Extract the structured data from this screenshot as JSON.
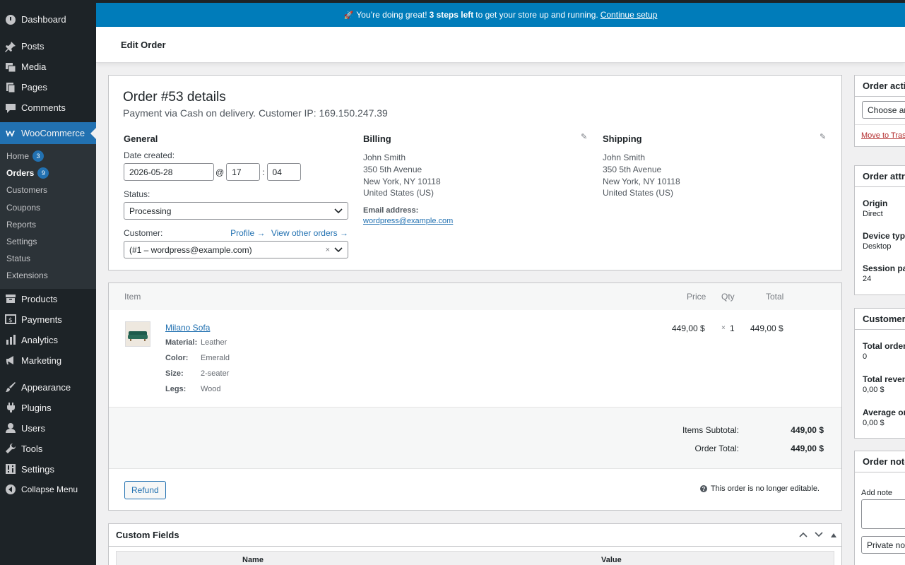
{
  "sidebar": {
    "top_items": [
      {
        "label": "Dashboard",
        "icon": "dashboard-icon"
      },
      {
        "label": "Posts",
        "icon": "pin-icon"
      },
      {
        "label": "Media",
        "icon": "media-icon"
      },
      {
        "label": "Pages",
        "icon": "pages-icon"
      },
      {
        "label": "Comments",
        "icon": "comment-icon"
      }
    ],
    "woocommerce_label": "WooCommerce",
    "sub_items": [
      {
        "label": "Home",
        "count": "3"
      },
      {
        "label": "Orders",
        "count": "9"
      },
      {
        "label": "Customers"
      },
      {
        "label": "Coupons"
      },
      {
        "label": "Reports"
      },
      {
        "label": "Settings"
      },
      {
        "label": "Status"
      },
      {
        "label": "Extensions"
      }
    ],
    "lower_items": [
      {
        "label": "Products"
      },
      {
        "label": "Payments"
      },
      {
        "label": "Analytics"
      },
      {
        "label": "Marketing"
      },
      {
        "label": "Appearance"
      },
      {
        "label": "Plugins"
      },
      {
        "label": "Users"
      },
      {
        "label": "Tools"
      },
      {
        "label": "Settings"
      },
      {
        "label": "Collapse Menu"
      }
    ]
  },
  "notice": {
    "emoji": "🚀",
    "text_before": "You’re doing great!",
    "bold": "3 steps left",
    "text_after": "to get your store up and running.",
    "link": "Continue setup"
  },
  "header": {
    "title": "Edit Order"
  },
  "order": {
    "title": "Order #53 details",
    "meta": "Payment via Cash on delivery. Customer IP: 169.150.247.39",
    "general_heading": "General",
    "date_label": "Date created:",
    "date": "2026-05-28",
    "at": "@",
    "hour": "17",
    "colon": ":",
    "minute": "04",
    "status_label": "Status:",
    "status": "Processing",
    "customer_label": "Customer:",
    "profile_link": "Profile →",
    "other_orders_link": "View other orders →",
    "customer": "(#1 – wordpress@example.com)",
    "billing": {
      "heading": "Billing",
      "name": "John Smith",
      "street": "350 5th Avenue",
      "city": "New York, NY 10118",
      "country": "United States (US)",
      "email_label": "Email address:",
      "email": "wordpress@example.com"
    },
    "shipping": {
      "heading": "Shipping",
      "name": "John Smith",
      "street": "350 5th Avenue",
      "city": "New York, NY 10118",
      "country": "United States (US)"
    }
  },
  "items": {
    "columns": {
      "item": "Item",
      "price": "Price",
      "qty": "Qty",
      "total": "Total"
    },
    "product": {
      "name": "Milano Sofa",
      "price": "449,00 $",
      "qty_x": "×",
      "qty": "1",
      "total": "449,00 $",
      "attributes": [
        {
          "label": "Material:",
          "value": "Leather"
        },
        {
          "label": "Color:",
          "value": "Emerald"
        },
        {
          "label": "Size:",
          "value": "2-seater"
        },
        {
          "label": "Legs:",
          "value": "Wood"
        }
      ]
    },
    "subtotal_label": "Items Subtotal:",
    "subtotal": "449,00 $",
    "total_label": "Order Total:",
    "total": "449,00 $",
    "refund_label": "Refund",
    "not_editable": "This order is no longer editable."
  },
  "custom_fields": {
    "heading": "Custom Fields",
    "col_name": "Name",
    "col_value": "Value"
  },
  "right": {
    "actions_title": "Order actions",
    "actions_select": "Choose an action...",
    "trash_link": "Move to Trash",
    "attribution_title": "Order attribution",
    "origin_label": "Origin",
    "origin": "Direct",
    "device_label": "Device type",
    "device": "Desktop",
    "session_label": "Session page views",
    "session": "24",
    "customer_title": "Customer history",
    "total_orders_label": "Total orders",
    "total_orders": "0",
    "total_revenue_label": "Total revenue",
    "total_revenue": "0,00 $",
    "average_label": "Average order value",
    "average": "0,00 $",
    "notes_title": "Order notes",
    "add_note_label": "Add note",
    "note_type": "Private note"
  },
  "colors": {
    "accent": "#2271b1",
    "notice": "#007cba",
    "sidebar": "#1d2327"
  }
}
